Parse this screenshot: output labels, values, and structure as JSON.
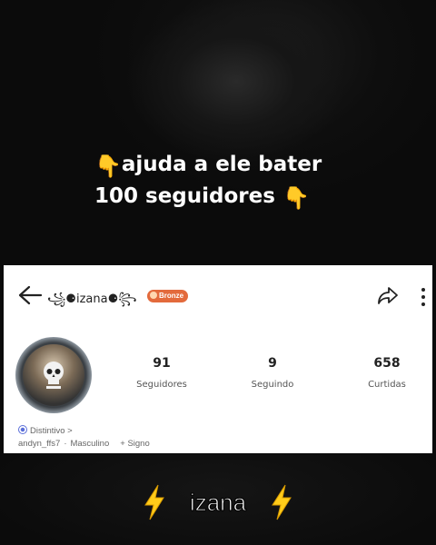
{
  "caption": {
    "line1": "ajuda a ele bater",
    "line2": "100 seguidores"
  },
  "profile": {
    "username": "꧁⚈izana⚈꧂",
    "badge": "Bronze",
    "stats": [
      {
        "value": "91",
        "label": "Seguidores"
      },
      {
        "value": "9",
        "label": "Seguindo"
      },
      {
        "value": "658",
        "label": "Curtidas"
      }
    ],
    "distintivo": "Distintivo >",
    "handle": "andyn_ffs7",
    "gender": "Masculino",
    "signo": "+ Signo"
  },
  "bottom": {
    "text": "izana"
  },
  "colors": {
    "badge": "#e36a3c",
    "bolt": "#ffcc1a",
    "hand": "#f5b83a"
  }
}
